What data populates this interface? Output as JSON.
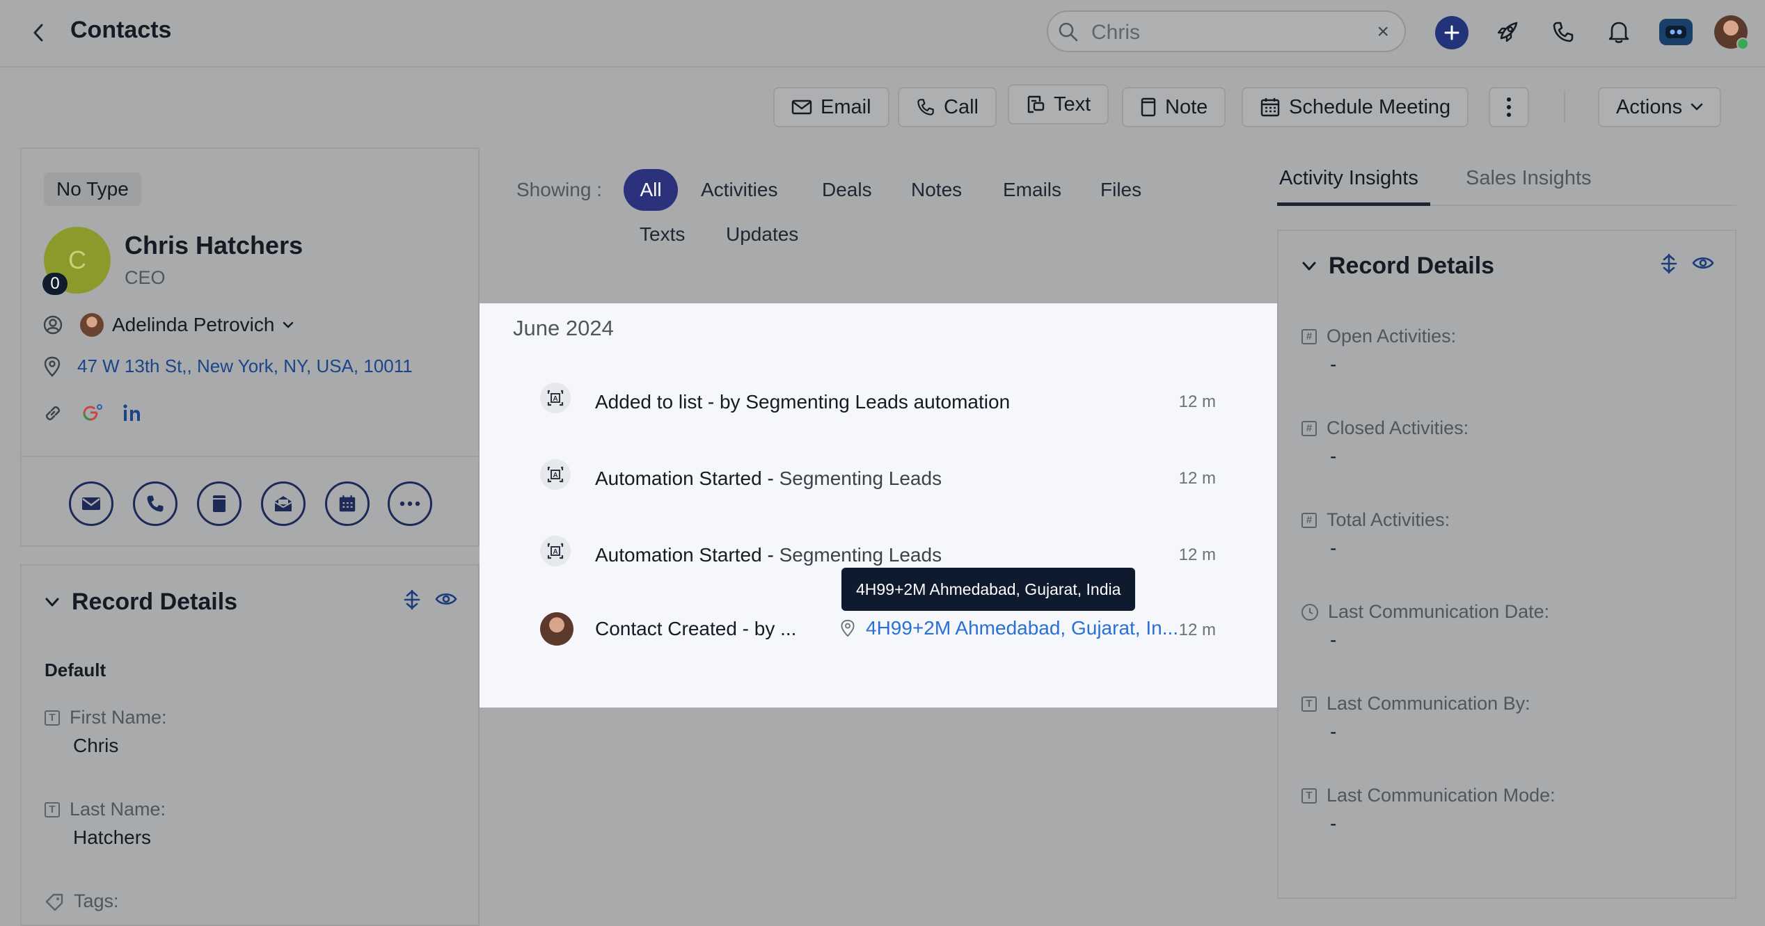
{
  "header": {
    "title": "Contacts",
    "search_placeholder": "Chris",
    "search_clear": "×"
  },
  "toolbar": {
    "email": "Email",
    "call": "Call",
    "text": "Text",
    "note": "Note",
    "schedule": "Schedule Meeting",
    "actions": "Actions"
  },
  "contact": {
    "type": "No Type",
    "initial": "C",
    "badge_count": "0",
    "name": "Chris Hatchers",
    "role": "CEO",
    "owner": "Adelinda Petrovich",
    "address": "47 W 13th St,, New York, NY, USA, 10011"
  },
  "left_details": {
    "title": "Record Details",
    "group": "Default",
    "fields": [
      {
        "label": "First Name:",
        "value": "Chris"
      },
      {
        "label": "Last Name:",
        "value": "Hatchers"
      },
      {
        "label": "Tags:",
        "value": ""
      }
    ]
  },
  "filters": {
    "label": "Showing :",
    "tabs": [
      "All",
      "Activities",
      "Deals",
      "Notes",
      "Emails",
      "Files",
      "Texts",
      "Updates"
    ],
    "active": "All"
  },
  "timeline": {
    "month": "June 2024",
    "items": [
      {
        "bold": "Added to list - by Segmenting Leads automation",
        "light": "",
        "time": "12 m"
      },
      {
        "bold": "Automation Started - ",
        "light": "Segmenting Leads",
        "time": "12 m"
      },
      {
        "bold": "Automation Started - ",
        "light": "Segmenting Leads",
        "time": "12 m"
      },
      {
        "bold": "Contact Created - by ...",
        "light": "",
        "time": "12 m",
        "location": "4H99+2M Ahmedabad, Gujarat, In..."
      }
    ],
    "tooltip": "4H99+2M Ahmedabad, Gujarat, India"
  },
  "right_tabs": {
    "tabs": [
      "Activity Insights",
      "Sales Insights"
    ],
    "active": "Activity Insights"
  },
  "right_details": {
    "title": "Record Details",
    "fields": [
      {
        "label": "Open Activities:",
        "value": "-",
        "icon": "hash-icon"
      },
      {
        "label": "Closed Activities:",
        "value": "-",
        "icon": "hash-icon"
      },
      {
        "label": "Total Activities:",
        "value": "-",
        "icon": "hash-icon"
      },
      {
        "label": "Last Communication Date:",
        "value": "-",
        "icon": "clock-icon"
      },
      {
        "label": "Last Communication By:",
        "value": "-",
        "icon": "text-field-icon"
      },
      {
        "label": "Last Communication Mode:",
        "value": "-",
        "icon": "text-field-icon"
      }
    ]
  },
  "colors": {
    "accent": "#2b317a",
    "link": "#2a6fd6",
    "tooltip_bg": "#0e1a2e",
    "avatar_bg": "#8c9a2c"
  }
}
